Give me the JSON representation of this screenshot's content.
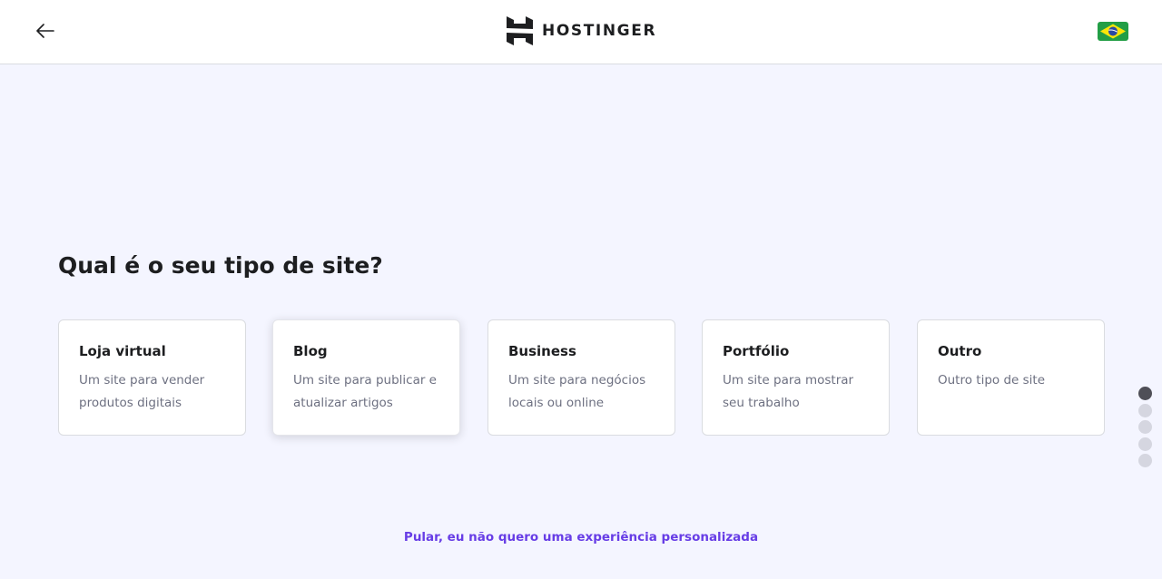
{
  "header": {
    "back_icon": "arrow-left-icon",
    "logo_text": "HOSTINGER",
    "logo_icon": "hostinger-h-logo",
    "flag_icon": "brazil-flag-icon"
  },
  "main": {
    "title": "Qual é o seu tipo de site?",
    "cards": [
      {
        "title": "Loja virtual",
        "description": "Um site para vender produtos digitais"
      },
      {
        "title": "Blog",
        "description": "Um site para publicar e atualizar artigos"
      },
      {
        "title": "Business",
        "description": "Um site para negócios locais ou online"
      },
      {
        "title": "Portfólio",
        "description": "Um site para mostrar seu trabalho"
      },
      {
        "title": "Outro",
        "description": "Outro tipo de site"
      }
    ],
    "active_card": 1
  },
  "pagination": {
    "total_steps": 5,
    "current_step": 1
  },
  "footer": {
    "skip_label": "Pular, eu não quero uma experiência personalizada"
  },
  "colors": {
    "accent": "#673de6",
    "background": "#f4f5ff",
    "text_primary": "#1d1e20",
    "text_secondary": "#6d7081",
    "dot_active": "#4f4f57",
    "dot_inactive": "#d5d6e0"
  }
}
